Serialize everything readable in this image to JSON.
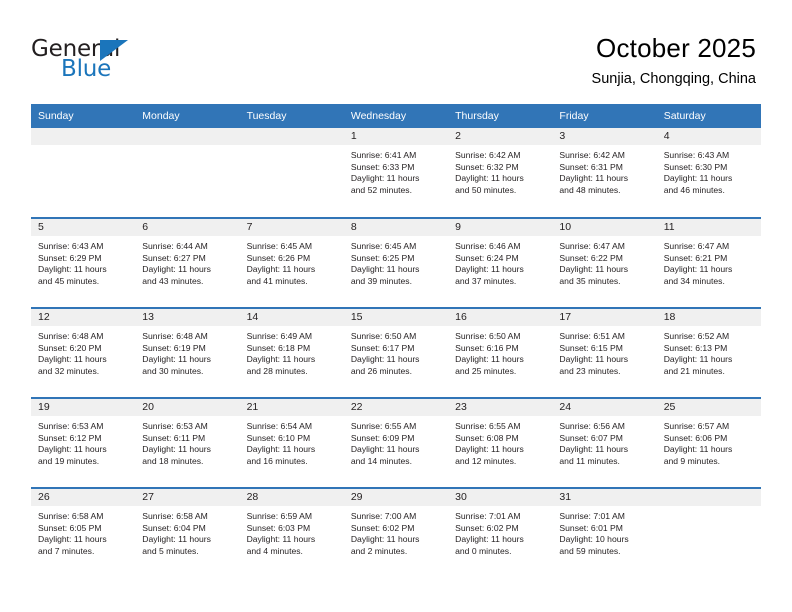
{
  "brand": {
    "name_top": "General",
    "name_bottom": "Blue",
    "accent_color": "#1b75bb"
  },
  "header": {
    "title": "October 2025",
    "subtitle": "Sunjia, Chongqing, China",
    "header_bg_color": "#3175b7",
    "header_text_color": "#ffffff",
    "day_band_color": "#f0f0f0"
  },
  "weekday_headers": [
    "Sunday",
    "Monday",
    "Tuesday",
    "Wednesday",
    "Thursday",
    "Friday",
    "Saturday"
  ],
  "weeks": [
    [
      {
        "day": "",
        "lines": []
      },
      {
        "day": "",
        "lines": []
      },
      {
        "day": "",
        "lines": []
      },
      {
        "day": "1",
        "lines": [
          "Sunrise: 6:41 AM",
          "Sunset: 6:33 PM",
          "Daylight: 11 hours",
          "and 52 minutes."
        ]
      },
      {
        "day": "2",
        "lines": [
          "Sunrise: 6:42 AM",
          "Sunset: 6:32 PM",
          "Daylight: 11 hours",
          "and 50 minutes."
        ]
      },
      {
        "day": "3",
        "lines": [
          "Sunrise: 6:42 AM",
          "Sunset: 6:31 PM",
          "Daylight: 11 hours",
          "and 48 minutes."
        ]
      },
      {
        "day": "4",
        "lines": [
          "Sunrise: 6:43 AM",
          "Sunset: 6:30 PM",
          "Daylight: 11 hours",
          "and 46 minutes."
        ]
      }
    ],
    [
      {
        "day": "5",
        "lines": [
          "Sunrise: 6:43 AM",
          "Sunset: 6:29 PM",
          "Daylight: 11 hours",
          "and 45 minutes."
        ]
      },
      {
        "day": "6",
        "lines": [
          "Sunrise: 6:44 AM",
          "Sunset: 6:27 PM",
          "Daylight: 11 hours",
          "and 43 minutes."
        ]
      },
      {
        "day": "7",
        "lines": [
          "Sunrise: 6:45 AM",
          "Sunset: 6:26 PM",
          "Daylight: 11 hours",
          "and 41 minutes."
        ]
      },
      {
        "day": "8",
        "lines": [
          "Sunrise: 6:45 AM",
          "Sunset: 6:25 PM",
          "Daylight: 11 hours",
          "and 39 minutes."
        ]
      },
      {
        "day": "9",
        "lines": [
          "Sunrise: 6:46 AM",
          "Sunset: 6:24 PM",
          "Daylight: 11 hours",
          "and 37 minutes."
        ]
      },
      {
        "day": "10",
        "lines": [
          "Sunrise: 6:47 AM",
          "Sunset: 6:22 PM",
          "Daylight: 11 hours",
          "and 35 minutes."
        ]
      },
      {
        "day": "11",
        "lines": [
          "Sunrise: 6:47 AM",
          "Sunset: 6:21 PM",
          "Daylight: 11 hours",
          "and 34 minutes."
        ]
      }
    ],
    [
      {
        "day": "12",
        "lines": [
          "Sunrise: 6:48 AM",
          "Sunset: 6:20 PM",
          "Daylight: 11 hours",
          "and 32 minutes."
        ]
      },
      {
        "day": "13",
        "lines": [
          "Sunrise: 6:48 AM",
          "Sunset: 6:19 PM",
          "Daylight: 11 hours",
          "and 30 minutes."
        ]
      },
      {
        "day": "14",
        "lines": [
          "Sunrise: 6:49 AM",
          "Sunset: 6:18 PM",
          "Daylight: 11 hours",
          "and 28 minutes."
        ]
      },
      {
        "day": "15",
        "lines": [
          "Sunrise: 6:50 AM",
          "Sunset: 6:17 PM",
          "Daylight: 11 hours",
          "and 26 minutes."
        ]
      },
      {
        "day": "16",
        "lines": [
          "Sunrise: 6:50 AM",
          "Sunset: 6:16 PM",
          "Daylight: 11 hours",
          "and 25 minutes."
        ]
      },
      {
        "day": "17",
        "lines": [
          "Sunrise: 6:51 AM",
          "Sunset: 6:15 PM",
          "Daylight: 11 hours",
          "and 23 minutes."
        ]
      },
      {
        "day": "18",
        "lines": [
          "Sunrise: 6:52 AM",
          "Sunset: 6:13 PM",
          "Daylight: 11 hours",
          "and 21 minutes."
        ]
      }
    ],
    [
      {
        "day": "19",
        "lines": [
          "Sunrise: 6:53 AM",
          "Sunset: 6:12 PM",
          "Daylight: 11 hours",
          "and 19 minutes."
        ]
      },
      {
        "day": "20",
        "lines": [
          "Sunrise: 6:53 AM",
          "Sunset: 6:11 PM",
          "Daylight: 11 hours",
          "and 18 minutes."
        ]
      },
      {
        "day": "21",
        "lines": [
          "Sunrise: 6:54 AM",
          "Sunset: 6:10 PM",
          "Daylight: 11 hours",
          "and 16 minutes."
        ]
      },
      {
        "day": "22",
        "lines": [
          "Sunrise: 6:55 AM",
          "Sunset: 6:09 PM",
          "Daylight: 11 hours",
          "and 14 minutes."
        ]
      },
      {
        "day": "23",
        "lines": [
          "Sunrise: 6:55 AM",
          "Sunset: 6:08 PM",
          "Daylight: 11 hours",
          "and 12 minutes."
        ]
      },
      {
        "day": "24",
        "lines": [
          "Sunrise: 6:56 AM",
          "Sunset: 6:07 PM",
          "Daylight: 11 hours",
          "and 11 minutes."
        ]
      },
      {
        "day": "25",
        "lines": [
          "Sunrise: 6:57 AM",
          "Sunset: 6:06 PM",
          "Daylight: 11 hours",
          "and 9 minutes."
        ]
      }
    ],
    [
      {
        "day": "26",
        "lines": [
          "Sunrise: 6:58 AM",
          "Sunset: 6:05 PM",
          "Daylight: 11 hours",
          "and 7 minutes."
        ]
      },
      {
        "day": "27",
        "lines": [
          "Sunrise: 6:58 AM",
          "Sunset: 6:04 PM",
          "Daylight: 11 hours",
          "and 5 minutes."
        ]
      },
      {
        "day": "28",
        "lines": [
          "Sunrise: 6:59 AM",
          "Sunset: 6:03 PM",
          "Daylight: 11 hours",
          "and 4 minutes."
        ]
      },
      {
        "day": "29",
        "lines": [
          "Sunrise: 7:00 AM",
          "Sunset: 6:02 PM",
          "Daylight: 11 hours",
          "and 2 minutes."
        ]
      },
      {
        "day": "30",
        "lines": [
          "Sunrise: 7:01 AM",
          "Sunset: 6:02 PM",
          "Daylight: 11 hours",
          "and 0 minutes."
        ]
      },
      {
        "day": "31",
        "lines": [
          "Sunrise: 7:01 AM",
          "Sunset: 6:01 PM",
          "Daylight: 10 hours",
          "and 59 minutes."
        ]
      },
      {
        "day": "",
        "lines": []
      }
    ]
  ]
}
